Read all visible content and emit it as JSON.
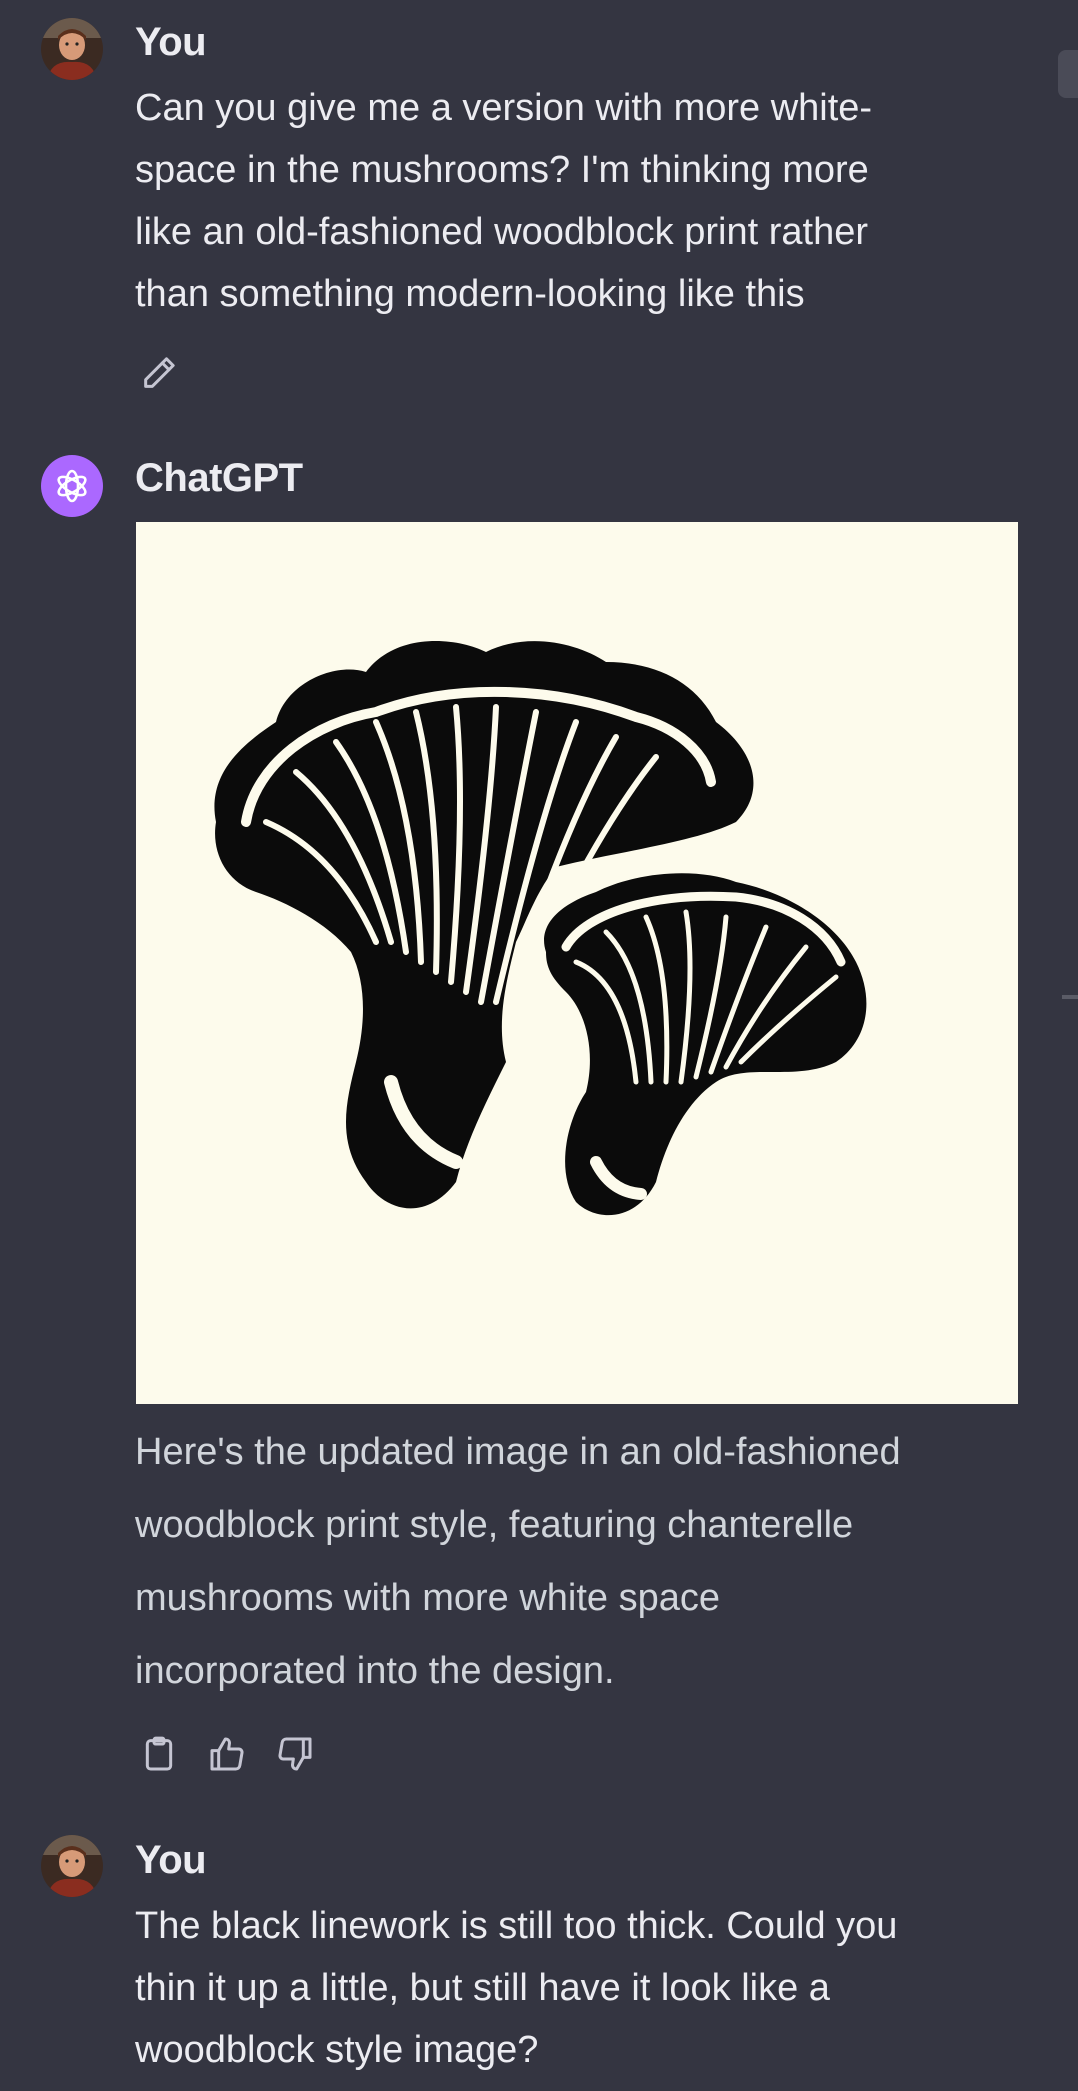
{
  "messages": [
    {
      "sender": "You",
      "avatar": "user-avatar-photo",
      "lines": [
        "Can you give me a version with more white-",
        "space in the mushrooms?  I'm thinking more",
        "like an old-fashioned woodblock print rather",
        "than something modern-looking like this"
      ],
      "actions": [
        "edit-icon"
      ]
    },
    {
      "sender": "ChatGPT",
      "avatar": "openai-logo-icon",
      "image": "chanterelle-mushrooms-woodblock-illustration",
      "lines": [
        "Here's the updated image in an old-fashioned",
        "woodblock print style, featuring chanterelle",
        "mushrooms with more white space",
        "incorporated into the design."
      ],
      "actions": [
        "copy-icon",
        "thumbs-up-icon",
        "thumbs-down-icon"
      ]
    },
    {
      "sender": "You",
      "avatar": "user-avatar-photo",
      "lines": [
        "The black linework is still too thick.  Could you",
        "thin it up a little, but still have it look like a",
        "woodblock style image?"
      ]
    }
  ],
  "colors": {
    "background": "#343541",
    "text": "#ececf1",
    "reply_text": "#d1d5db",
    "chatgpt_avatar": "#ab68ff",
    "image_paper": "#fdfbec",
    "ink": "#0b0b0b"
  }
}
